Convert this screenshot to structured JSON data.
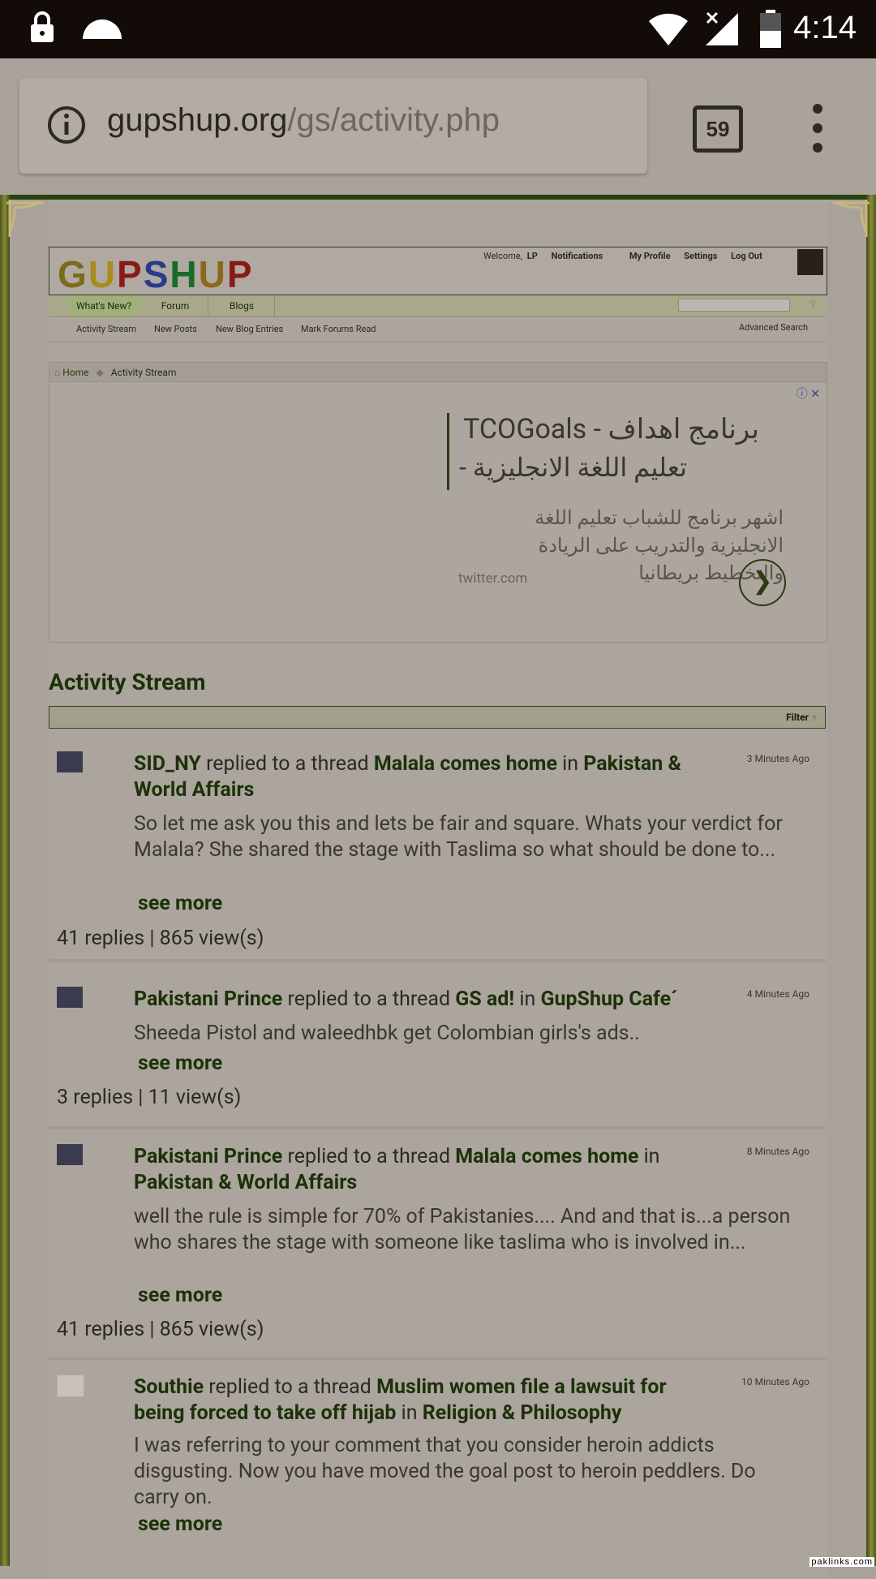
{
  "status_bar": {
    "time": "4:14"
  },
  "browser": {
    "url_domain": "gupshup.org",
    "url_path": "/gs/activity.php",
    "tab_count": "59"
  },
  "site": {
    "logo": "GUPSHUP",
    "top_links": {
      "welcome": "Welcome,",
      "user": "LP",
      "notifications": "Notifications",
      "my_profile": "My Profile",
      "settings": "Settings",
      "log_out": "Log Out"
    },
    "nav_tabs": [
      "What's New?",
      "Forum",
      "Blogs"
    ],
    "sub_nav": [
      "Activity Stream",
      "New Posts",
      "New Blog Entries",
      "Mark Forums Read"
    ],
    "advanced_search": "Advanced Search",
    "breadcrumb": {
      "home": "Home",
      "current": "Activity Stream"
    }
  },
  "ad": {
    "title_line1": "TCOGoals - برنامج اهداف",
    "title_line2": "- تعليم اللغة الانجليزية",
    "body": "اشهر برنامج للشباب تعليم اللغة الانجليزية والتدريب على الريادة والتخطيط بريطانيا",
    "domain": "twitter.com"
  },
  "activity": {
    "heading": "Activity Stream",
    "filter_label": "Filter",
    "items": [
      {
        "user": "SID_NY",
        "action": "replied to a thread",
        "thread": "Malala comes home",
        "in_word": "in",
        "forum": "Pakistan & World Affairs",
        "time": "3 Minutes Ago",
        "excerpt": "So let me ask you this and lets be fair and square. Whats your verdict for Malala? She shared the stage with Taslima so what should be done to...",
        "see_more": "see more",
        "stats": "41 replies | 865 view(s)"
      },
      {
        "user": "Pakistani Prince",
        "action": "replied to a thread",
        "thread": "GS ad!",
        "in_word": "in",
        "forum": "GupShup Cafe´",
        "time": "4 Minutes Ago",
        "excerpt": "Sheeda Pistol and waleedhbk get Colombian girls's ads..",
        "see_more": "see more",
        "stats": "3 replies | 11 view(s)"
      },
      {
        "user": "Pakistani Prince",
        "action": "replied to a thread",
        "thread": "Malala comes home",
        "in_word": "in",
        "forum": "Pakistan & World Affairs",
        "time": "8 Minutes Ago",
        "excerpt": "well the rule is simple for 70% of Pakistanies.... And and that is...a person who shares the stage with someone like taslima who is involved in...",
        "see_more": "see more",
        "stats": "41 replies | 865 view(s)"
      },
      {
        "user": "Southie",
        "action": "replied to a thread",
        "thread": "Muslim women file a lawsuit for being forced to take off hijab",
        "in_word": "in",
        "forum": "Religion & Philosophy",
        "time": "10 Minutes Ago",
        "excerpt": "I was referring to your comment that you consider heroin addicts disgusting. Now you have moved the goal post to heroin peddlers. Do carry on.",
        "see_more": "see more"
      }
    ]
  },
  "watermark": "paklinks.com"
}
